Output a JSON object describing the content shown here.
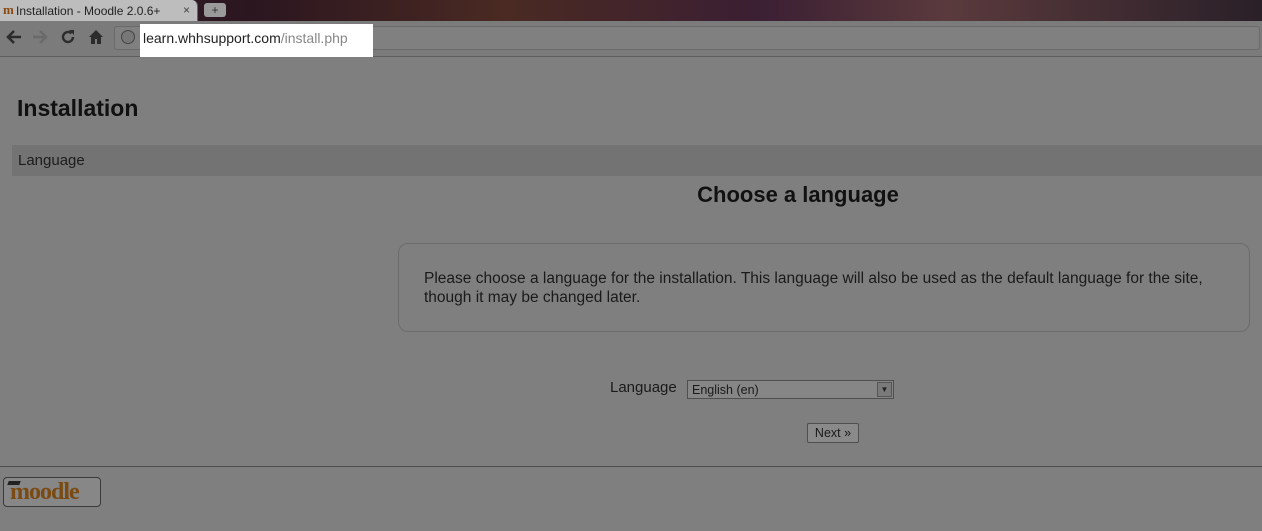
{
  "browser": {
    "tab_title": "Installation - Moodle 2.0.6+",
    "tab_close": "×",
    "new_tab": "+",
    "favicon": "m",
    "url_host": "learn.whhsupport.com",
    "url_path": "/install.php",
    "icons": [
      "back-arrow-icon",
      "forward-arrow-icon",
      "reload-icon",
      "home-icon",
      "globe-icon"
    ]
  },
  "page": {
    "title": "Installation",
    "breadcrumb": "Language",
    "heading": "Choose a language",
    "info_text": "Please choose a language for the installation. This language will also be used as the default language for the site, though it may be changed later.",
    "language_label": "Language",
    "language_value": "English (en)",
    "next_button": "Next »",
    "logo_text": "moodle"
  }
}
